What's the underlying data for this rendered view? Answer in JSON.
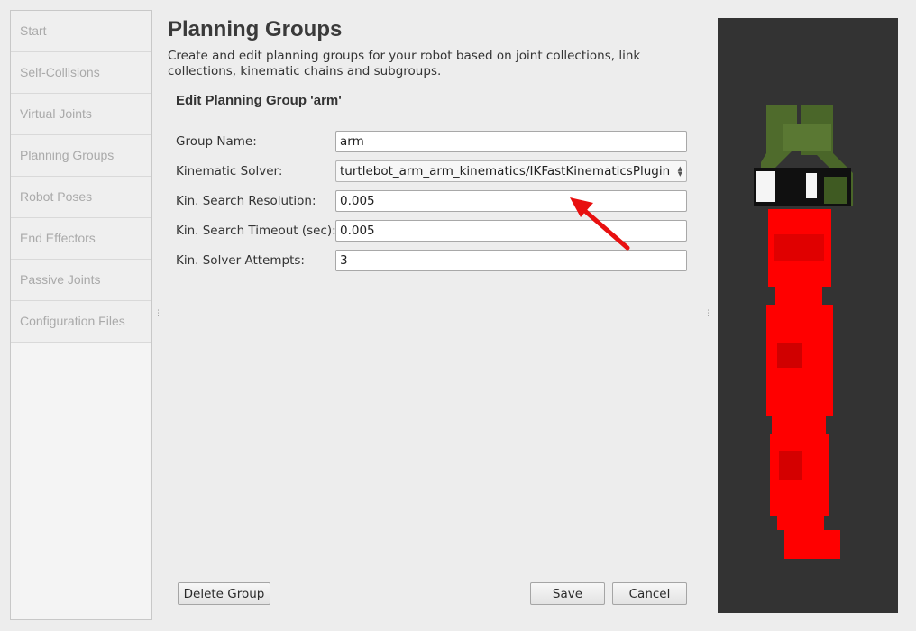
{
  "sidebar": {
    "items": [
      {
        "label": "Start"
      },
      {
        "label": "Self-Collisions"
      },
      {
        "label": "Virtual Joints"
      },
      {
        "label": "Planning Groups"
      },
      {
        "label": "Robot Poses"
      },
      {
        "label": "End Effectors"
      },
      {
        "label": "Passive Joints"
      },
      {
        "label": "Configuration Files"
      }
    ]
  },
  "main": {
    "title": "Planning Groups",
    "description": "Create and edit planning groups for your robot based on joint collections, link collections, kinematic chains and subgroups.",
    "section_title": "Edit Planning Group 'arm'",
    "form": {
      "group_name": {
        "label": "Group Name:",
        "value": "arm"
      },
      "kinematic_solver": {
        "label": "Kinematic Solver:",
        "value": "turtlebot_arm_arm_kinematics/IKFastKinematicsPlugin"
      },
      "search_resolution": {
        "label": "Kin. Search Resolution:",
        "value": "0.005"
      },
      "search_timeout": {
        "label": "Kin. Search Timeout (sec):",
        "value": "0.005"
      },
      "solver_attempts": {
        "label": "Kin. Solver Attempts:",
        "value": "3"
      }
    },
    "buttons": {
      "delete": "Delete Group",
      "save": "Save",
      "cancel": "Cancel"
    }
  },
  "colors": {
    "annotation_arrow": "#e81010",
    "viewport_bg": "#333333",
    "robot_link": "#ff0000",
    "gripper": "#4f6b2c"
  },
  "icons": {
    "splitter": "splitter-handle-icon",
    "spin": "spin-arrows-icon"
  }
}
